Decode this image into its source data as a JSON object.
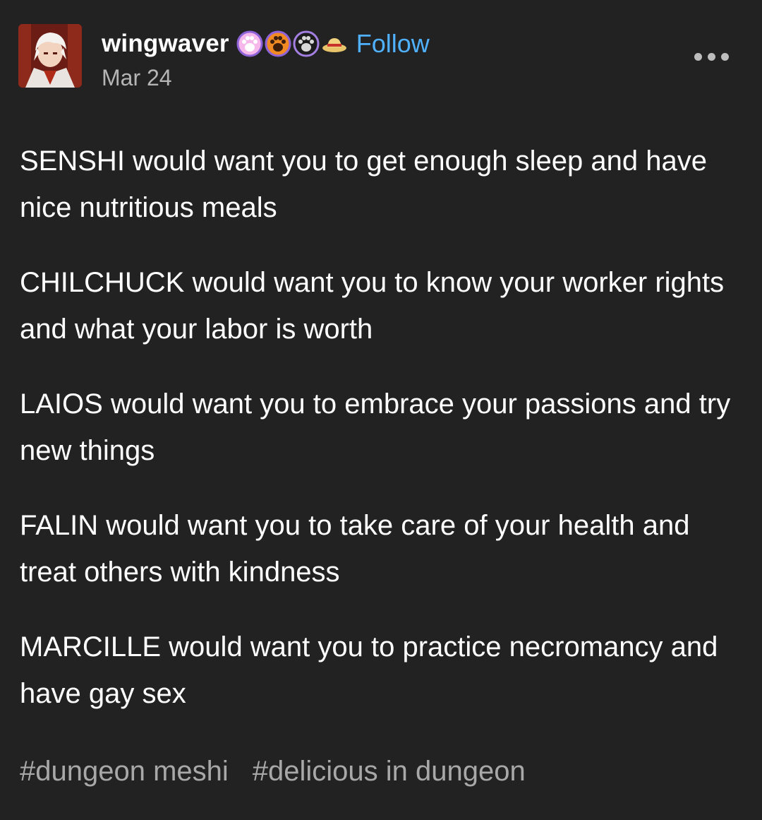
{
  "post": {
    "author": {
      "username": "wingwaver",
      "date": "Mar 24",
      "badges": [
        "pink-paw-badge-icon",
        "orange-paw-badge-icon",
        "purple-paw-badge-icon",
        "straw-hat-badge-icon"
      ]
    },
    "follow_label": "Follow",
    "paragraphs": [
      "SENSHI would want you to get enough sleep and have nice nutritious meals",
      "CHILCHUCK would want you to know your worker rights and what your labor is worth",
      "LAIOS would want you to embrace your passions and try new things",
      "FALIN would want you to take care of your health and treat others with kindness",
      "MARCILLE would want you to practice necromancy and have gay sex"
    ],
    "tags": [
      "#dungeon meshi",
      "#delicious in dungeon"
    ]
  },
  "colors": {
    "background": "#222222",
    "text": "#ffffff",
    "follow": "#4fb1ff",
    "muted": "#a8a8a8"
  }
}
